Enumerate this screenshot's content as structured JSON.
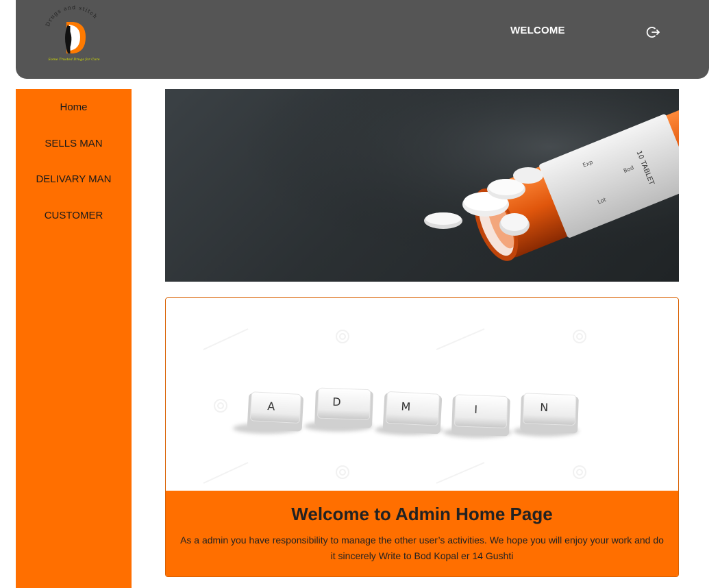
{
  "header": {
    "logo": {
      "top_text": "Drugs and stitch",
      "tagline": "Some Trusted Drugs for Cure"
    },
    "welcome_label": "WELCOME",
    "logout_icon": "logout-icon"
  },
  "sidebar": {
    "items": [
      {
        "label": "Home"
      },
      {
        "label": "SELLS MAN"
      },
      {
        "label": "DELIVARY MAN"
      },
      {
        "label": "CUSTOMER"
      }
    ]
  },
  "hero": {
    "bottle_label_lines": [
      "10 TABLET",
      "Bod",
      "Exp",
      "Lot"
    ]
  },
  "card": {
    "image_keys": [
      "A",
      "D",
      "M",
      "I",
      "N"
    ],
    "title": "Welcome to Admin Home Page",
    "text": "As a admin you have responsibility to manage the other user’s activities. We hope you will enjoy your work and do it sincerely Write to Bod Kopal er 14 Gushti"
  },
  "colors": {
    "header_bg": "#555555",
    "accent": "#ff6f00",
    "text_dark": "#222222"
  }
}
